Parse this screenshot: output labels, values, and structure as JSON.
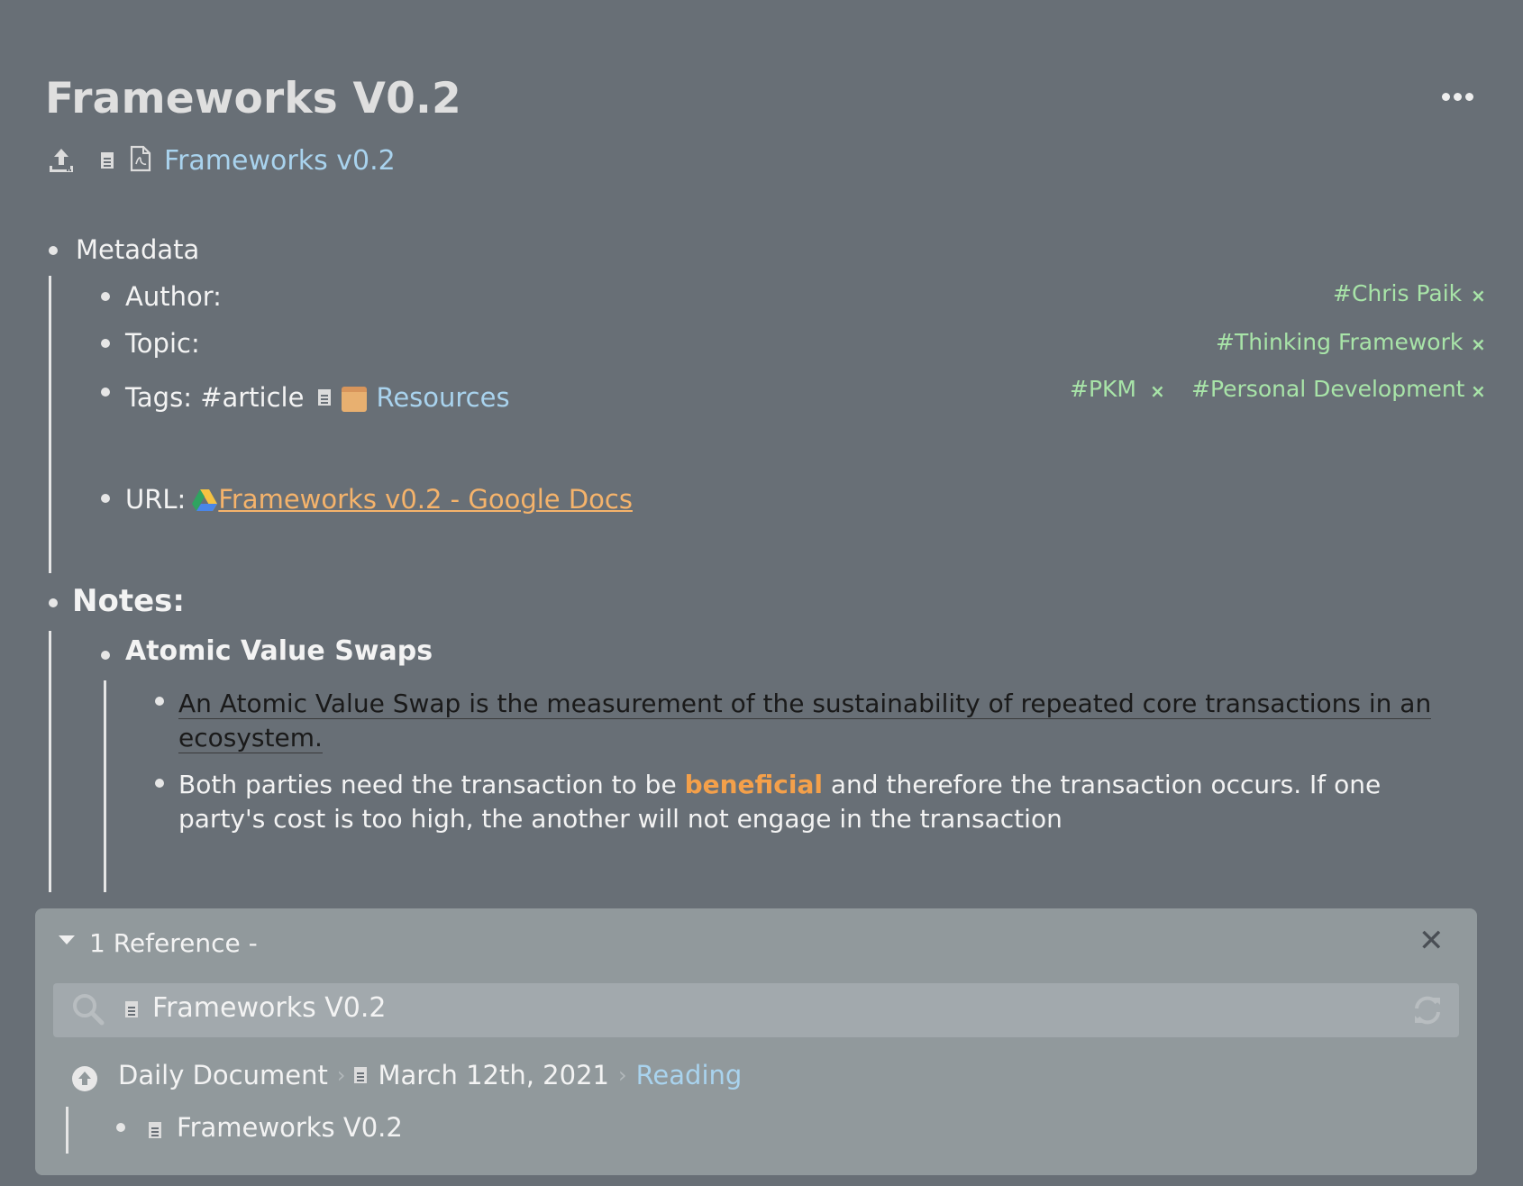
{
  "page": {
    "title": "Frameworks V0.2",
    "attachment_link": "Frameworks v0.2"
  },
  "metadata": {
    "heading": "Metadata",
    "author_label": "Author:",
    "topic_label": "Topic:",
    "tags_prefix": "Tags: #article",
    "tags_link": "Resources",
    "url_label": "URL:",
    "url_link": " Frameworks v0.2 - Google Docs"
  },
  "tags_right": {
    "author_tag": "#Chris Paik",
    "topic_tag": "#Thinking Framework",
    "tag_pkm": "#PKM",
    "tag_personal": "#Personal Development",
    "remove_glyph": "×"
  },
  "notes": {
    "heading": "Notes:",
    "subheading": "Atomic Value Swaps",
    "para1": "An Atomic Value Swap is the measurement of the sustainability of repeated core transactions in an ecosystem.",
    "para2_before": "Both parties need the transaction to be ",
    "para2_highlight": "beneficial",
    "para2_after": " and therefore the transaction occurs. If one party's cost is too high, the another will not engage in the transaction"
  },
  "references": {
    "count_label": "1 Reference -",
    "close_glyph": "✕",
    "search_value": "Frameworks V0.2",
    "breadcrumb": {
      "item1": "Daily Document",
      "item2": "March 12th, 2021",
      "item3": "Reading"
    },
    "result_link": "Frameworks V0.2"
  },
  "colors": {
    "background": "#686f76",
    "link": "#a9d3ee",
    "tag": "#a8e4a8",
    "accent_orange": "#f5b36b",
    "panel": "#91999c"
  }
}
